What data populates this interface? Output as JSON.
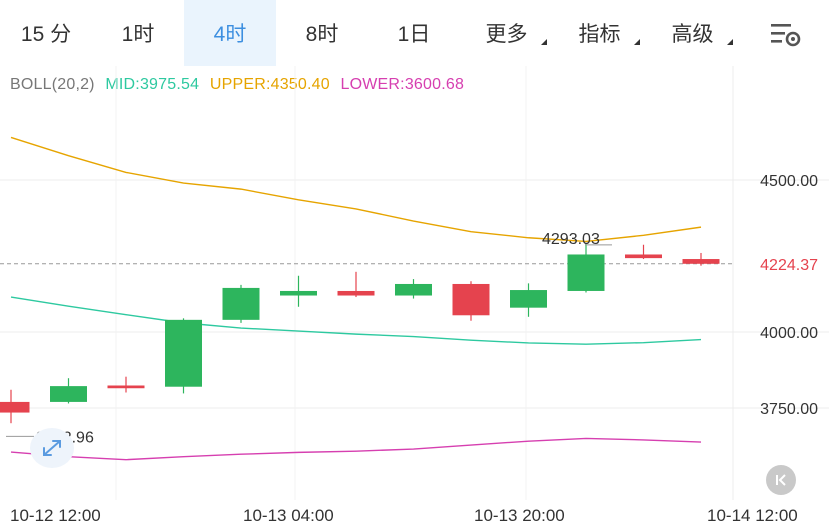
{
  "tabs": [
    {
      "label": "15 分",
      "active": false,
      "dropdown": false
    },
    {
      "label": "1时",
      "active": false,
      "dropdown": false
    },
    {
      "label": "4时",
      "active": true,
      "dropdown": false
    },
    {
      "label": "8时",
      "active": false,
      "dropdown": false
    },
    {
      "label": "1日",
      "active": false,
      "dropdown": false
    },
    {
      "label": "更多",
      "active": false,
      "dropdown": true
    },
    {
      "label": "指标",
      "active": false,
      "dropdown": true
    },
    {
      "label": "高级",
      "active": false,
      "dropdown": true
    }
  ],
  "settings_icon": "chart-settings-icon",
  "legend": {
    "boll": "BOLL(20,2)",
    "mid": "MID:3975.54",
    "upper": "UPPER:4350.40",
    "lower": "LOWER:3600.68"
  },
  "colors": {
    "up": "#2db55d",
    "down": "#e5434e",
    "mid": "#2ec9a0",
    "upper": "#e6a400",
    "lower": "#d63fb0",
    "active_tab_bg": "#eaf4fd",
    "active_tab_text": "#3d8fe0"
  },
  "axis": {
    "y_ticks": [
      "4500.00",
      "4000.00",
      "3750.00"
    ],
    "x_ticks": [
      "10-12 12:00",
      "10-13 04:00",
      "10-13 20:00",
      "10-14 12:00"
    ]
  },
  "annotations": {
    "high_label": "4293.03",
    "low_label": "3692.96",
    "last_price": "4224.37"
  },
  "icons": {
    "expand": "expand-arrows-icon",
    "collapse": "collapse-left-icon"
  },
  "chart_data": {
    "type": "candlestick",
    "title": "",
    "ylim": [
      3560,
      4700
    ],
    "candles": [
      {
        "o": 3770,
        "h": 3810,
        "l": 3700,
        "c": 3735
      },
      {
        "o": 3770,
        "h": 3848,
        "l": 3765,
        "c": 3822
      },
      {
        "o": 3824,
        "h": 3853,
        "l": 3801,
        "c": 3815
      },
      {
        "o": 3820,
        "h": 4045,
        "l": 3798,
        "c": 4040
      },
      {
        "o": 4040,
        "h": 4155,
        "l": 4030,
        "c": 4145
      },
      {
        "o": 4120,
        "h": 4185,
        "l": 4083,
        "c": 4135
      },
      {
        "o": 4135,
        "h": 4198,
        "l": 4115,
        "c": 4120
      },
      {
        "o": 4120,
        "h": 4174,
        "l": 4110,
        "c": 4158
      },
      {
        "o": 4158,
        "h": 4167,
        "l": 4037,
        "c": 4055
      },
      {
        "o": 4080,
        "h": 4160,
        "l": 4050,
        "c": 4138
      },
      {
        "o": 4135,
        "h": 4293.03,
        "l": 4130,
        "c": 4255
      },
      {
        "o": 4255,
        "h": 4287,
        "l": 4240,
        "c": 4243
      },
      {
        "o": 4240,
        "h": 4260,
        "l": 4218,
        "c": 4224.37
      }
    ],
    "upper": [
      4640,
      4580,
      4525,
      4490,
      4470,
      4435,
      4405,
      4365,
      4330,
      4310,
      4298,
      4318,
      4345
    ],
    "mid": [
      4115,
      4085,
      4057,
      4030,
      4013,
      4003,
      3993,
      3985,
      3973,
      3964,
      3960,
      3965,
      3975
    ],
    "lower": [
      3605,
      3590,
      3580,
      3590,
      3598,
      3604,
      3608,
      3615,
      3628,
      3641,
      3650,
      3645,
      3638
    ]
  }
}
